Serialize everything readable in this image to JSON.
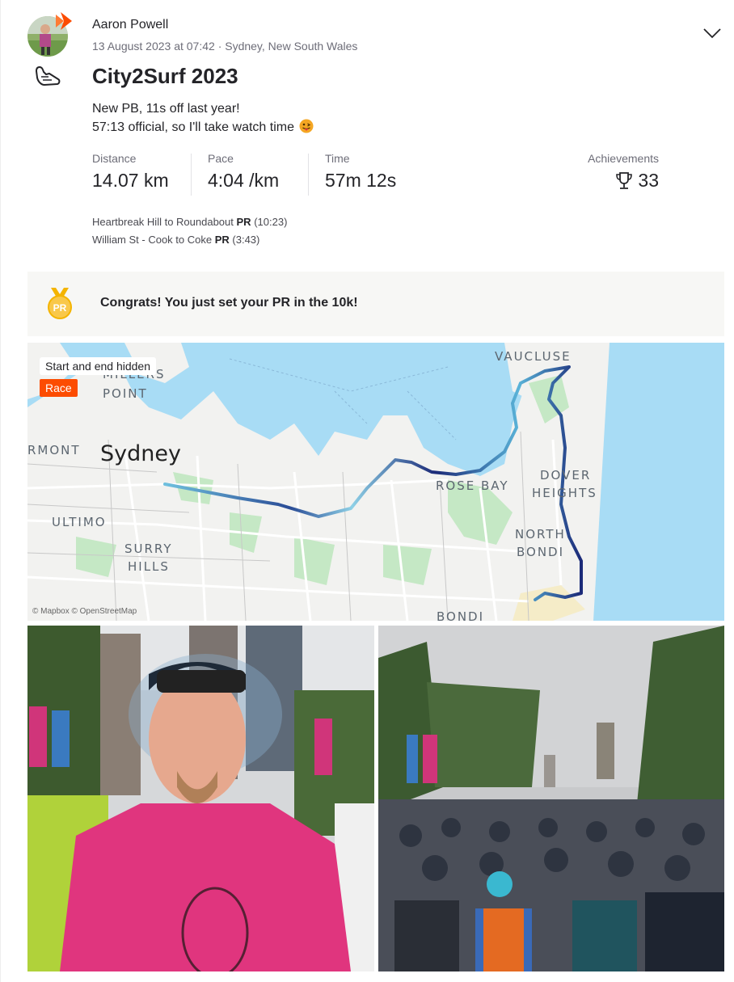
{
  "header": {
    "athlete_name": "Aaron Powell",
    "meta": "13 August 2023 at 07:42 · Sydney, New South Wales",
    "sport_icon": "running-shoe-icon",
    "menu_icon": "chevron-down-icon"
  },
  "activity": {
    "title": "City2Surf 2023",
    "description_line1": "New PB, 11s off last year!",
    "description_line2": "57:13 official, so I'll take watch time"
  },
  "stats": [
    {
      "label": "Distance",
      "value": "14.07 km"
    },
    {
      "label": "Pace",
      "value": "4:04 /km"
    },
    {
      "label": "Time",
      "value": "57m 12s"
    }
  ],
  "achievements": {
    "label": "Achievements",
    "count": "33",
    "icon": "trophy-icon"
  },
  "segments": [
    {
      "name": "Heartbreak Hill to Roundabout",
      "badge": "PR",
      "time": "(10:23)"
    },
    {
      "name": "William St - Cook to Coke",
      "badge": "PR",
      "time": "(3:43)"
    }
  ],
  "pr_banner": {
    "text": "Congrats! You just set your PR in the 10k!",
    "icon": "pr-medal-icon",
    "medal_text": "PR"
  },
  "map": {
    "hidden_label": "Start and end hidden",
    "race_tag": "Race",
    "city": "Sydney",
    "labels": {
      "millers_point_1": "MILLERS",
      "millers_point_2": "POINT",
      "pyrmont": "RMONT",
      "ultimo": "ULTIMO",
      "surry_1": "SURRY",
      "surry_2": "HILLS",
      "vaucluse": "VAUCLUSE",
      "rose_bay": "ROSE BAY",
      "dover_1": "DOVER",
      "dover_2": "HEIGHTS",
      "north_bondi_1": "NORTH",
      "north_bondi_2": "BONDI",
      "bondi": "BONDI"
    },
    "attribution": "© Mapbox © OpenStreetMap",
    "colors": {
      "water": "#a8dcf5",
      "land": "#f2f2f0",
      "park": "#c5e8c5",
      "route_dark": "#1b2a78",
      "route_light": "#6fc0de"
    }
  },
  "photos": [
    {
      "alt": "selfie-photo"
    },
    {
      "alt": "crowd-photo"
    }
  ]
}
